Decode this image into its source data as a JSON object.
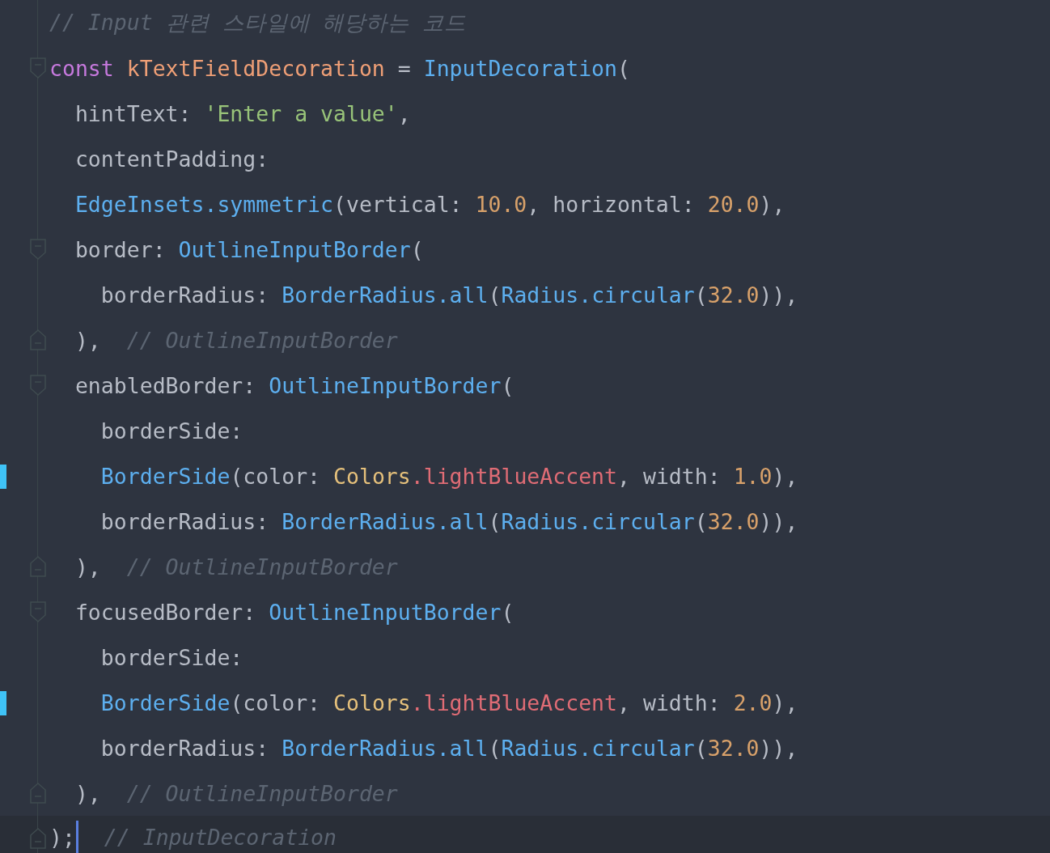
{
  "editor": {
    "lines": [
      {
        "kind": "plain",
        "modified": false,
        "current": false,
        "tokens": [
          {
            "kind": "comment",
            "text": "// Input 관련 스타일에 해당하는 코드"
          }
        ]
      },
      {
        "kind": "fold-start",
        "modified": false,
        "current": false,
        "tokens": [
          {
            "kind": "keyword",
            "text": "const "
          },
          {
            "kind": "variable",
            "text": "kTextFieldDecoration"
          },
          {
            "kind": "plain",
            "text": " = "
          },
          {
            "kind": "type",
            "text": "InputDecoration"
          },
          {
            "kind": "plain",
            "text": "("
          }
        ]
      },
      {
        "kind": "plain",
        "modified": false,
        "current": false,
        "tokens": [
          {
            "kind": "plain",
            "text": "  hintText: "
          },
          {
            "kind": "string",
            "text": "'Enter a value'"
          },
          {
            "kind": "plain",
            "text": ","
          }
        ]
      },
      {
        "kind": "plain",
        "modified": false,
        "current": false,
        "tokens": [
          {
            "kind": "plain",
            "text": "  contentPadding:"
          }
        ]
      },
      {
        "kind": "plain",
        "modified": false,
        "current": false,
        "tokens": [
          {
            "kind": "type",
            "text": "  EdgeInsets"
          },
          {
            "kind": "type",
            "text": ".symmetric"
          },
          {
            "kind": "plain",
            "text": "(vertical: "
          },
          {
            "kind": "number",
            "text": "10.0"
          },
          {
            "kind": "plain",
            "text": ", horizontal: "
          },
          {
            "kind": "number",
            "text": "20.0"
          },
          {
            "kind": "plain",
            "text": "),"
          }
        ]
      },
      {
        "kind": "fold-start",
        "modified": false,
        "current": false,
        "tokens": [
          {
            "kind": "plain",
            "text": "  border: "
          },
          {
            "kind": "type",
            "text": "OutlineInputBorder"
          },
          {
            "kind": "plain",
            "text": "("
          }
        ]
      },
      {
        "kind": "plain",
        "modified": false,
        "current": false,
        "tokens": [
          {
            "kind": "plain",
            "text": "    borderRadius: "
          },
          {
            "kind": "type",
            "text": "BorderRadius"
          },
          {
            "kind": "type",
            "text": ".all"
          },
          {
            "kind": "plain",
            "text": "("
          },
          {
            "kind": "type",
            "text": "Radius"
          },
          {
            "kind": "type",
            "text": ".circular"
          },
          {
            "kind": "plain",
            "text": "("
          },
          {
            "kind": "number",
            "text": "32.0"
          },
          {
            "kind": "plain",
            "text": ")),"
          }
        ]
      },
      {
        "kind": "fold-end",
        "modified": false,
        "current": false,
        "tokens": [
          {
            "kind": "plain",
            "text": "  ),"
          },
          {
            "kind": "comment",
            "text": "  // OutlineInputBorder"
          }
        ]
      },
      {
        "kind": "fold-start",
        "modified": false,
        "current": false,
        "tokens": [
          {
            "kind": "plain",
            "text": "  enabledBorder: "
          },
          {
            "kind": "type",
            "text": "OutlineInputBorder"
          },
          {
            "kind": "plain",
            "text": "("
          }
        ]
      },
      {
        "kind": "plain",
        "modified": false,
        "current": false,
        "tokens": [
          {
            "kind": "plain",
            "text": "    borderSide:"
          }
        ]
      },
      {
        "kind": "plain",
        "modified": true,
        "current": false,
        "tokens": [
          {
            "kind": "type",
            "text": "    BorderSide"
          },
          {
            "kind": "plain",
            "text": "(color: "
          },
          {
            "kind": "static",
            "text": "Colors"
          },
          {
            "kind": "member",
            "text": ".lightBlueAccent"
          },
          {
            "kind": "plain",
            "text": ", width: "
          },
          {
            "kind": "number",
            "text": "1.0"
          },
          {
            "kind": "plain",
            "text": "),"
          }
        ]
      },
      {
        "kind": "plain",
        "modified": false,
        "current": false,
        "tokens": [
          {
            "kind": "plain",
            "text": "    borderRadius: "
          },
          {
            "kind": "type",
            "text": "BorderRadius"
          },
          {
            "kind": "type",
            "text": ".all"
          },
          {
            "kind": "plain",
            "text": "("
          },
          {
            "kind": "type",
            "text": "Radius"
          },
          {
            "kind": "type",
            "text": ".circular"
          },
          {
            "kind": "plain",
            "text": "("
          },
          {
            "kind": "number",
            "text": "32.0"
          },
          {
            "kind": "plain",
            "text": ")),"
          }
        ]
      },
      {
        "kind": "fold-end",
        "modified": false,
        "current": false,
        "tokens": [
          {
            "kind": "plain",
            "text": "  ),"
          },
          {
            "kind": "comment",
            "text": "  // OutlineInputBorder"
          }
        ]
      },
      {
        "kind": "fold-start",
        "modified": false,
        "current": false,
        "tokens": [
          {
            "kind": "plain",
            "text": "  focusedBorder: "
          },
          {
            "kind": "type",
            "text": "OutlineInputBorder"
          },
          {
            "kind": "plain",
            "text": "("
          }
        ]
      },
      {
        "kind": "plain",
        "modified": false,
        "current": false,
        "tokens": [
          {
            "kind": "plain",
            "text": "    borderSide:"
          }
        ]
      },
      {
        "kind": "plain",
        "modified": true,
        "current": false,
        "tokens": [
          {
            "kind": "type",
            "text": "    BorderSide"
          },
          {
            "kind": "plain",
            "text": "(color: "
          },
          {
            "kind": "static",
            "text": "Colors"
          },
          {
            "kind": "member",
            "text": ".lightBlueAccent"
          },
          {
            "kind": "plain",
            "text": ", width: "
          },
          {
            "kind": "number",
            "text": "2.0"
          },
          {
            "kind": "plain",
            "text": "),"
          }
        ]
      },
      {
        "kind": "plain",
        "modified": false,
        "current": false,
        "tokens": [
          {
            "kind": "plain",
            "text": "    borderRadius: "
          },
          {
            "kind": "type",
            "text": "BorderRadius"
          },
          {
            "kind": "type",
            "text": ".all"
          },
          {
            "kind": "plain",
            "text": "("
          },
          {
            "kind": "type",
            "text": "Radius"
          },
          {
            "kind": "type",
            "text": ".circular"
          },
          {
            "kind": "plain",
            "text": "("
          },
          {
            "kind": "number",
            "text": "32.0"
          },
          {
            "kind": "plain",
            "text": ")),"
          }
        ]
      },
      {
        "kind": "fold-end",
        "modified": false,
        "current": false,
        "tokens": [
          {
            "kind": "plain",
            "text": "  ),"
          },
          {
            "kind": "comment",
            "text": "  // OutlineInputBorder"
          }
        ]
      },
      {
        "kind": "fold-end",
        "modified": false,
        "current": true,
        "tokens": [
          {
            "kind": "plain",
            "text": ");",
            "caret": true
          },
          {
            "kind": "comment",
            "text": "  // InputDecoration"
          }
        ]
      }
    ]
  }
}
